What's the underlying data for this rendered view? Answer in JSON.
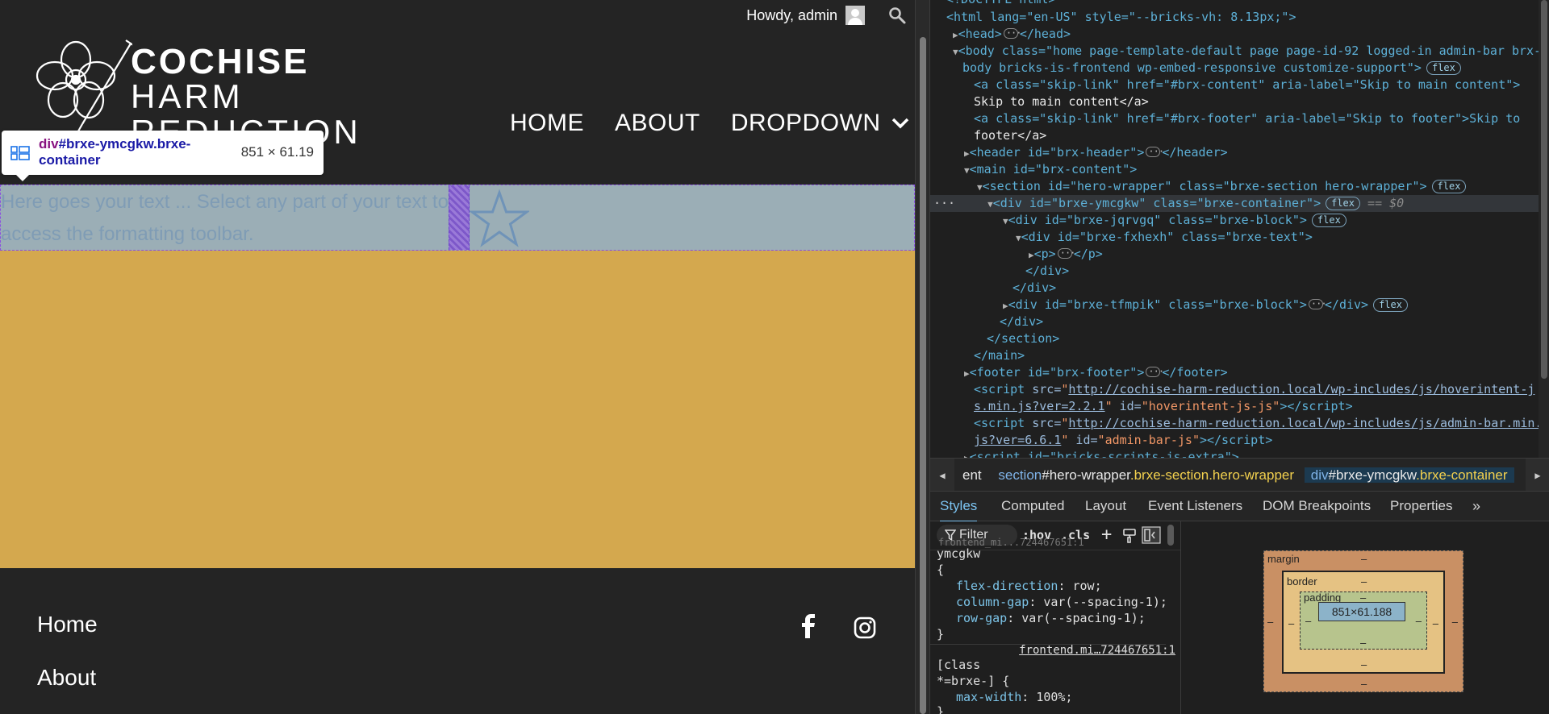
{
  "site": {
    "admin_greeting": "Howdy, admin",
    "logo": {
      "line1": "COCHISE",
      "line2": "HARM",
      "line3": "REDUCTION"
    },
    "nav": [
      {
        "label": "HOME"
      },
      {
        "label": "ABOUT"
      },
      {
        "label": "DROPDOWN"
      }
    ],
    "hero_text": "Here goes your text ... Select any part of your text to access the formatting toolbar.",
    "tooltip": {
      "tag": "div",
      "selector": "#brxe-ymcgkw.brxe-container",
      "size": "851 × 61.19"
    },
    "footer": {
      "links": [
        "Home",
        "About"
      ]
    },
    "colors": {
      "hero_bg": "#d4a84e",
      "page_bg": "#242424",
      "highlight": "#9baeb6"
    }
  },
  "devtools": {
    "dom": {
      "l0": "<!DOCTYPE html>",
      "html_open": "<html lang=\"en-US\" style=\"--bricks-vh: 8.13px;\">",
      "head": "<head>",
      "head_close": "</head>",
      "body_open_a": "<body class=\"home page-template-default page page-id-92 logged-in admin-bar brx-",
      "body_open_b": "body bricks-is-frontend wp-embed-responsive customize-support\">",
      "skip1_a": "<a class=\"skip-link\" href=\"#brx-content\" aria-label=\"Skip to main content\">",
      "skip1_b": "Skip to main content</a>",
      "skip2_a": "<a class=\"skip-link\" href=\"#brx-footer\" aria-label=\"Skip to footer\">Skip to",
      "skip2_b": "footer</a>",
      "header": "<header id=\"brx-header\">",
      "header_close": "</header>",
      "main_open": "<main id=\"brx-content\">",
      "section_open": "<section id=\"hero-wrapper\" class=\"brxe-section hero-wrapper\">",
      "div_container": "<div id=\"brxe-ymcgkw\" class=\"brxe-container\">",
      "selected_marker": "== $0",
      "div_block1": "<div id=\"brxe-jqrvgq\" class=\"brxe-block\">",
      "div_text": "<div id=\"brxe-fxhexh\" class=\"brxe-text\">",
      "p": "<p>",
      "p_close": "</p>",
      "div_close": "</div>",
      "div_block2": "<div id=\"brxe-tfmpik\" class=\"brxe-block\">",
      "div_block2_close": "</div>",
      "section_close": "</section>",
      "main_close": "</main>",
      "footer": "<footer id=\"brx-footer\">",
      "footer_close": "</footer>",
      "script1_a": "http://cochise-harm-reduction.local/wp-includes/js/hoverintent-j",
      "script1_b": "s.min.js?ver=2.2.1",
      "script1_id": "hoverintent-js-js",
      "script2_a": "http://cochise-harm-reduction.local/wp-includes/js/admin-bar.min.",
      "script2_b": "js?ver=6.6.1",
      "script2_id": "admin-bar-js",
      "script3": "<script id=\"bricks-scripts-js-extra\">",
      "flex": "flex"
    },
    "breadcrumbs": [
      {
        "text": "ent"
      },
      {
        "tag": "section",
        "id": "#hero-wrapper",
        "cls": ".brxe-section.hero-wrapper"
      },
      {
        "tag": "div",
        "id": "#brxe-ymcgkw",
        "cls": ".brxe-container"
      }
    ],
    "tabs": [
      "Styles",
      "Computed",
      "Layout",
      "Event Listeners",
      "DOM Breakpoints",
      "Properties"
    ],
    "styles": {
      "filter_placeholder": "Filter",
      "hov": ":hov",
      "cls": ".cls",
      "rule1_selector_top": "frontend_mi...724467651:1",
      "rule1_selector": "ymcgkw",
      "rule1_props": [
        {
          "name": "flex-direction",
          "value": "row;"
        },
        {
          "name": "column-gap",
          "value": "var(--spacing-1);"
        },
        {
          "name": "row-gap",
          "value": "var(--spacing-1);"
        }
      ],
      "rule2_source": "frontend.mi…724467651:1",
      "rule2_selector_a": "[class",
      "rule2_selector_b": "*=brxe-] {",
      "rule2_props": [
        {
          "name": "max-width",
          "value": "100%;"
        }
      ]
    },
    "box_model": {
      "margin_label": "margin",
      "border_label": "border",
      "padding_label": "padding",
      "content": "851×61.188",
      "dash": "–"
    }
  }
}
